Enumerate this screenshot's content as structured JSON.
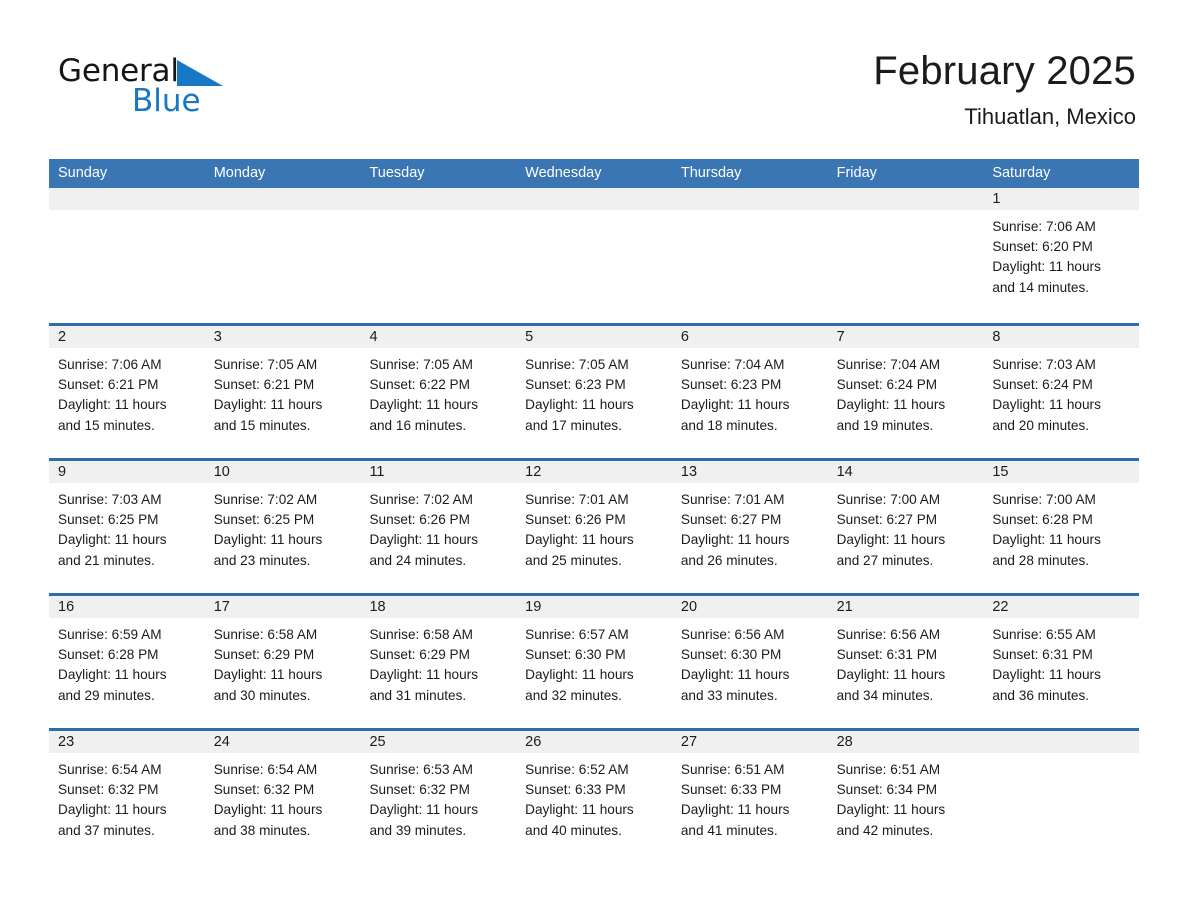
{
  "brand": {
    "name_top": "General",
    "name_bottom": "Blue",
    "triangle_icon": "brand-triangle-icon",
    "colors": {
      "black": "#151515",
      "blue": "#1878c4"
    }
  },
  "header": {
    "title": "February 2025",
    "subtitle": "Tihuatlan, Mexico"
  },
  "theme": {
    "header_blue": "#3a76b4",
    "row_rule_blue": "#2e6da8",
    "day_band_gray": "#f0f0f0",
    "text": "#1b1b1b"
  },
  "weekdays": [
    "Sunday",
    "Monday",
    "Tuesday",
    "Wednesday",
    "Thursday",
    "Friday",
    "Saturday"
  ],
  "weeks": [
    [
      {
        "day": "",
        "sunrise": "",
        "sunset": "",
        "daylight1": "",
        "daylight2": ""
      },
      {
        "day": "",
        "sunrise": "",
        "sunset": "",
        "daylight1": "",
        "daylight2": ""
      },
      {
        "day": "",
        "sunrise": "",
        "sunset": "",
        "daylight1": "",
        "daylight2": ""
      },
      {
        "day": "",
        "sunrise": "",
        "sunset": "",
        "daylight1": "",
        "daylight2": ""
      },
      {
        "day": "",
        "sunrise": "",
        "sunset": "",
        "daylight1": "",
        "daylight2": ""
      },
      {
        "day": "",
        "sunrise": "",
        "sunset": "",
        "daylight1": "",
        "daylight2": ""
      },
      {
        "day": "1",
        "sunrise": "Sunrise: 7:06 AM",
        "sunset": "Sunset: 6:20 PM",
        "daylight1": "Daylight: 11 hours",
        "daylight2": "and 14 minutes."
      }
    ],
    [
      {
        "day": "2",
        "sunrise": "Sunrise: 7:06 AM",
        "sunset": "Sunset: 6:21 PM",
        "daylight1": "Daylight: 11 hours",
        "daylight2": "and 15 minutes."
      },
      {
        "day": "3",
        "sunrise": "Sunrise: 7:05 AM",
        "sunset": "Sunset: 6:21 PM",
        "daylight1": "Daylight: 11 hours",
        "daylight2": "and 15 minutes."
      },
      {
        "day": "4",
        "sunrise": "Sunrise: 7:05 AM",
        "sunset": "Sunset: 6:22 PM",
        "daylight1": "Daylight: 11 hours",
        "daylight2": "and 16 minutes."
      },
      {
        "day": "5",
        "sunrise": "Sunrise: 7:05 AM",
        "sunset": "Sunset: 6:23 PM",
        "daylight1": "Daylight: 11 hours",
        "daylight2": "and 17 minutes."
      },
      {
        "day": "6",
        "sunrise": "Sunrise: 7:04 AM",
        "sunset": "Sunset: 6:23 PM",
        "daylight1": "Daylight: 11 hours",
        "daylight2": "and 18 minutes."
      },
      {
        "day": "7",
        "sunrise": "Sunrise: 7:04 AM",
        "sunset": "Sunset: 6:24 PM",
        "daylight1": "Daylight: 11 hours",
        "daylight2": "and 19 minutes."
      },
      {
        "day": "8",
        "sunrise": "Sunrise: 7:03 AM",
        "sunset": "Sunset: 6:24 PM",
        "daylight1": "Daylight: 11 hours",
        "daylight2": "and 20 minutes."
      }
    ],
    [
      {
        "day": "9",
        "sunrise": "Sunrise: 7:03 AM",
        "sunset": "Sunset: 6:25 PM",
        "daylight1": "Daylight: 11 hours",
        "daylight2": "and 21 minutes."
      },
      {
        "day": "10",
        "sunrise": "Sunrise: 7:02 AM",
        "sunset": "Sunset: 6:25 PM",
        "daylight1": "Daylight: 11 hours",
        "daylight2": "and 23 minutes."
      },
      {
        "day": "11",
        "sunrise": "Sunrise: 7:02 AM",
        "sunset": "Sunset: 6:26 PM",
        "daylight1": "Daylight: 11 hours",
        "daylight2": "and 24 minutes."
      },
      {
        "day": "12",
        "sunrise": "Sunrise: 7:01 AM",
        "sunset": "Sunset: 6:26 PM",
        "daylight1": "Daylight: 11 hours",
        "daylight2": "and 25 minutes."
      },
      {
        "day": "13",
        "sunrise": "Sunrise: 7:01 AM",
        "sunset": "Sunset: 6:27 PM",
        "daylight1": "Daylight: 11 hours",
        "daylight2": "and 26 minutes."
      },
      {
        "day": "14",
        "sunrise": "Sunrise: 7:00 AM",
        "sunset": "Sunset: 6:27 PM",
        "daylight1": "Daylight: 11 hours",
        "daylight2": "and 27 minutes."
      },
      {
        "day": "15",
        "sunrise": "Sunrise: 7:00 AM",
        "sunset": "Sunset: 6:28 PM",
        "daylight1": "Daylight: 11 hours",
        "daylight2": "and 28 minutes."
      }
    ],
    [
      {
        "day": "16",
        "sunrise": "Sunrise: 6:59 AM",
        "sunset": "Sunset: 6:28 PM",
        "daylight1": "Daylight: 11 hours",
        "daylight2": "and 29 minutes."
      },
      {
        "day": "17",
        "sunrise": "Sunrise: 6:58 AM",
        "sunset": "Sunset: 6:29 PM",
        "daylight1": "Daylight: 11 hours",
        "daylight2": "and 30 minutes."
      },
      {
        "day": "18",
        "sunrise": "Sunrise: 6:58 AM",
        "sunset": "Sunset: 6:29 PM",
        "daylight1": "Daylight: 11 hours",
        "daylight2": "and 31 minutes."
      },
      {
        "day": "19",
        "sunrise": "Sunrise: 6:57 AM",
        "sunset": "Sunset: 6:30 PM",
        "daylight1": "Daylight: 11 hours",
        "daylight2": "and 32 minutes."
      },
      {
        "day": "20",
        "sunrise": "Sunrise: 6:56 AM",
        "sunset": "Sunset: 6:30 PM",
        "daylight1": "Daylight: 11 hours",
        "daylight2": "and 33 minutes."
      },
      {
        "day": "21",
        "sunrise": "Sunrise: 6:56 AM",
        "sunset": "Sunset: 6:31 PM",
        "daylight1": "Daylight: 11 hours",
        "daylight2": "and 34 minutes."
      },
      {
        "day": "22",
        "sunrise": "Sunrise: 6:55 AM",
        "sunset": "Sunset: 6:31 PM",
        "daylight1": "Daylight: 11 hours",
        "daylight2": "and 36 minutes."
      }
    ],
    [
      {
        "day": "23",
        "sunrise": "Sunrise: 6:54 AM",
        "sunset": "Sunset: 6:32 PM",
        "daylight1": "Daylight: 11 hours",
        "daylight2": "and 37 minutes."
      },
      {
        "day": "24",
        "sunrise": "Sunrise: 6:54 AM",
        "sunset": "Sunset: 6:32 PM",
        "daylight1": "Daylight: 11 hours",
        "daylight2": "and 38 minutes."
      },
      {
        "day": "25",
        "sunrise": "Sunrise: 6:53 AM",
        "sunset": "Sunset: 6:32 PM",
        "daylight1": "Daylight: 11 hours",
        "daylight2": "and 39 minutes."
      },
      {
        "day": "26",
        "sunrise": "Sunrise: 6:52 AM",
        "sunset": "Sunset: 6:33 PM",
        "daylight1": "Daylight: 11 hours",
        "daylight2": "and 40 minutes."
      },
      {
        "day": "27",
        "sunrise": "Sunrise: 6:51 AM",
        "sunset": "Sunset: 6:33 PM",
        "daylight1": "Daylight: 11 hours",
        "daylight2": "and 41 minutes."
      },
      {
        "day": "28",
        "sunrise": "Sunrise: 6:51 AM",
        "sunset": "Sunset: 6:34 PM",
        "daylight1": "Daylight: 11 hours",
        "daylight2": "and 42 minutes."
      },
      {
        "day": "",
        "sunrise": "",
        "sunset": "",
        "daylight1": "",
        "daylight2": ""
      }
    ]
  ]
}
